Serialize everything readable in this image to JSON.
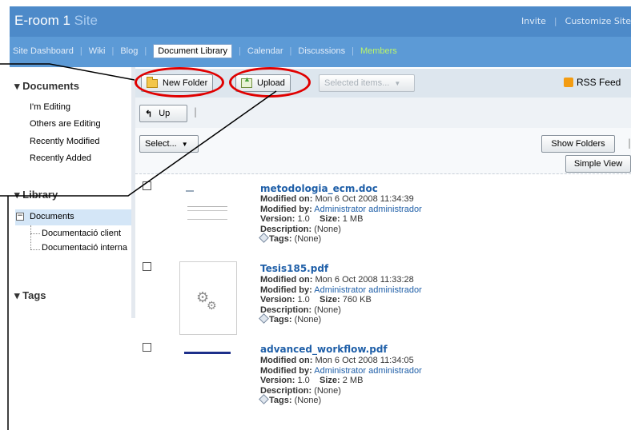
{
  "header": {
    "title": "E-room 1",
    "site_word": "Site",
    "links": [
      "Invite",
      "Customize Site"
    ]
  },
  "nav": {
    "items": [
      "Site Dashboard",
      "Wiki",
      "Blog",
      "Document Library",
      "Calendar",
      "Discussions",
      "Members"
    ],
    "active": "Document Library"
  },
  "sidebar": {
    "documents_heading": "Documents",
    "documents_links": [
      "I'm Editing",
      "Others are Editing",
      "Recently Modified",
      "Recently Added"
    ],
    "library_heading": "Library",
    "tree_root": "Documents",
    "tree_children": [
      "Documentació client",
      "Documentació interna"
    ],
    "tags_heading": "Tags"
  },
  "toolbar": {
    "new_folder": "New Folder",
    "upload": "Upload",
    "selected_items": "Selected items...",
    "rss": "RSS Feed",
    "up": "Up",
    "select": "Select...",
    "show_folders": "Show Folders",
    "simple_view": "Simple View"
  },
  "labels": {
    "modified_on": "Modified on:",
    "modified_by": "Modified by:",
    "version": "Version:",
    "size": "Size:",
    "description": "Description:",
    "tags": "Tags:"
  },
  "documents": [
    {
      "name": "metodologia_ecm.doc",
      "modified_on": "Mon 6 Oct 2008 11:34:39",
      "modified_by": "Administrator administrador",
      "version": "1.0",
      "size": "1 MB",
      "description": "(None)",
      "tags": "(None)"
    },
    {
      "name": "Tesis185.pdf",
      "modified_on": "Mon 6 Oct 2008 11:33:28",
      "modified_by": "Administrator administrador",
      "version": "1.0",
      "size": "760 KB",
      "description": "(None)",
      "tags": "(None)"
    },
    {
      "name": "advanced_workflow.pdf",
      "modified_on": "Mon 6 Oct 2008 11:34:05",
      "modified_by": "Administrator administrador",
      "version": "1.0",
      "size": "2 MB",
      "description": "(None)",
      "tags": "(None)"
    }
  ],
  "colors": {
    "header": "#4d8ac9",
    "nav": "#5c9ad6",
    "link": "#1f5fa8",
    "annotation": "#e00000",
    "members": "#b9f46b"
  }
}
